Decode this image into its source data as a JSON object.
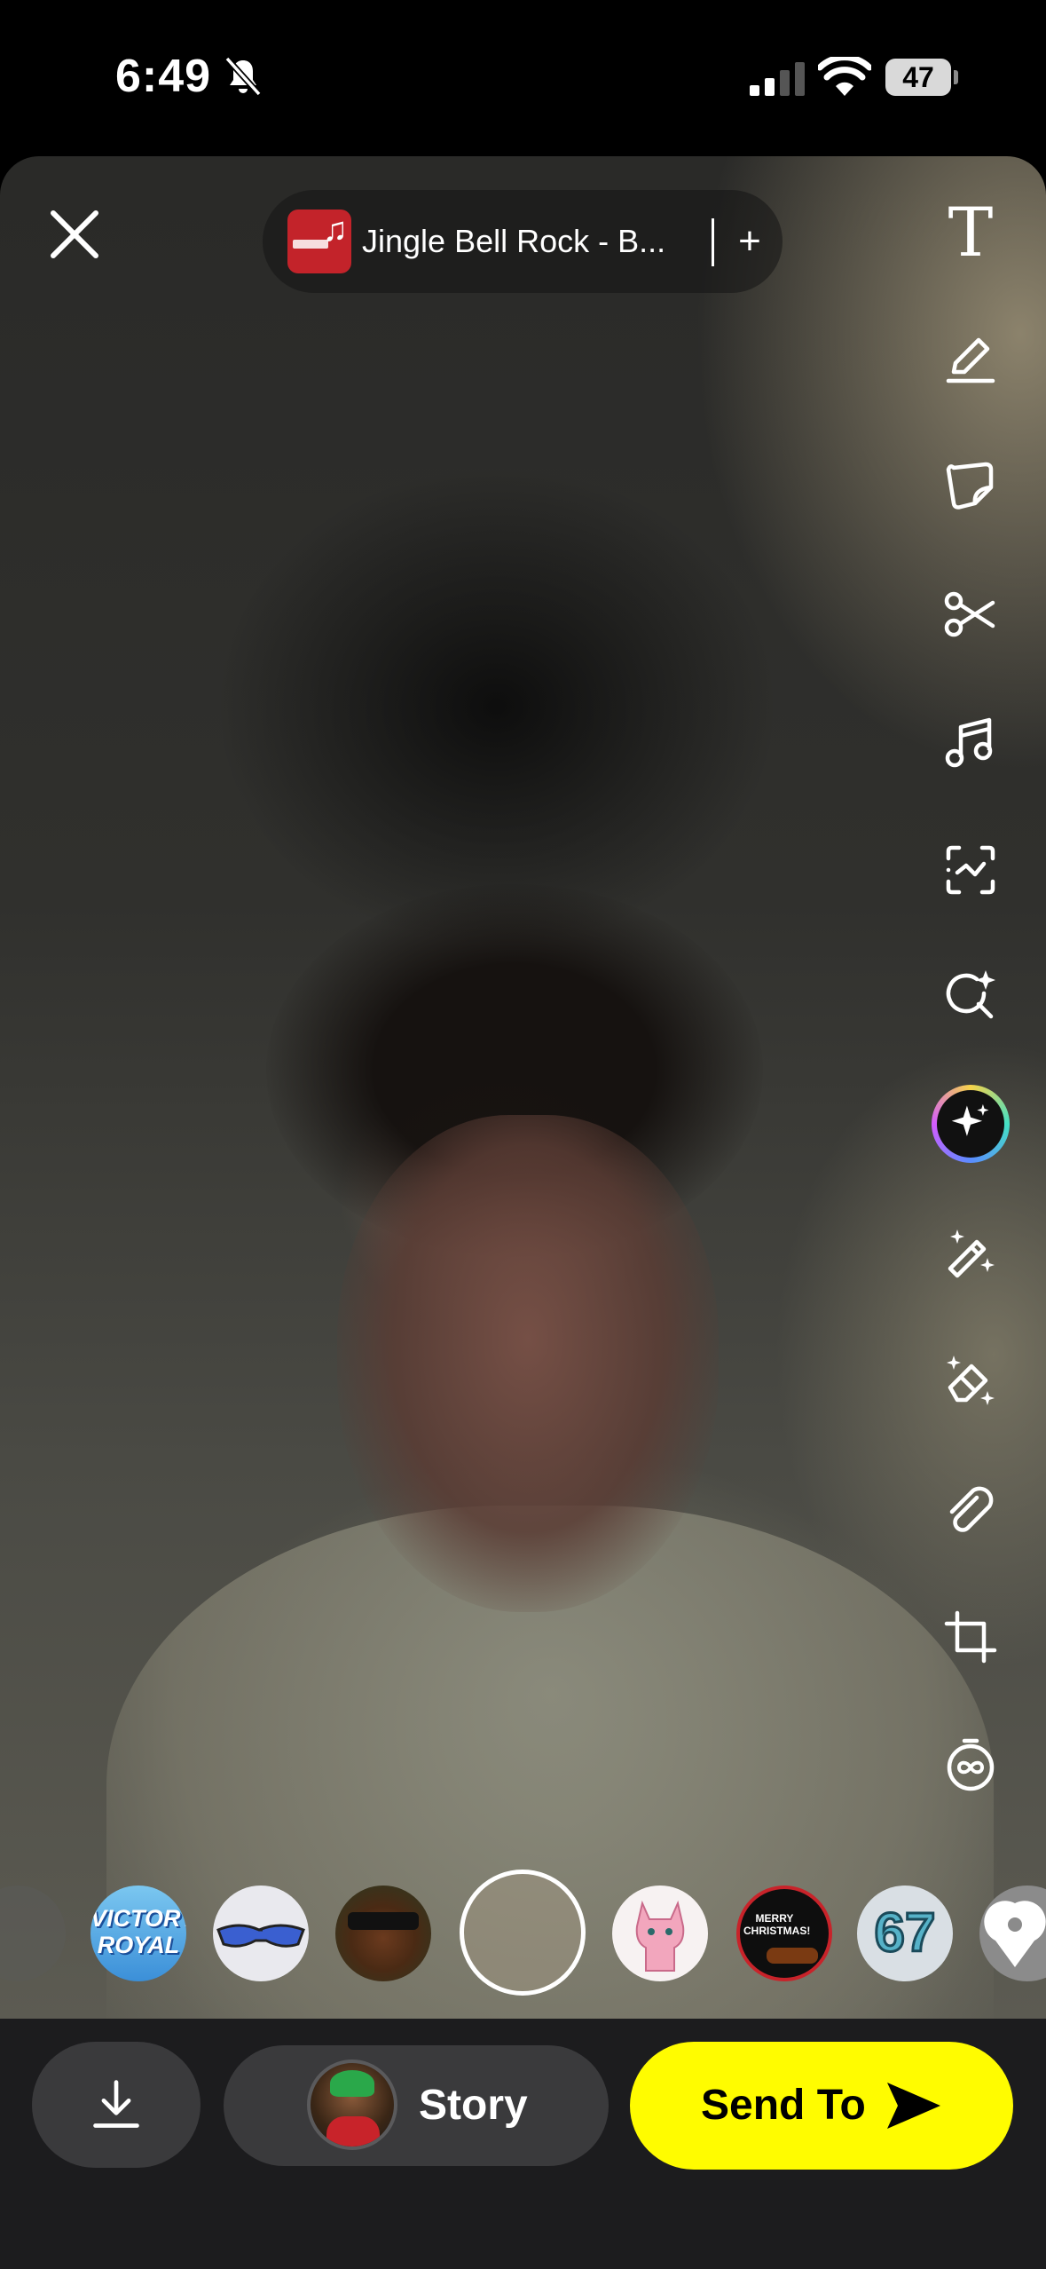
{
  "status_bar": {
    "time": "6:49",
    "battery": "47",
    "icons": [
      "bell-slash-icon",
      "cellular-signal-icon",
      "wifi-icon",
      "battery-icon"
    ]
  },
  "top_bar": {
    "close_icon": "close-icon",
    "music": {
      "track": "Jingle Bell Rock - B...",
      "add_label": "+"
    }
  },
  "tools": {
    "text_label": "T",
    "items": [
      "text-tool",
      "pen-icon",
      "sticker-icon",
      "scissors-icon",
      "music-note-icon",
      "scan-icon",
      "lens-search-icon",
      "ai-sparkle-icon",
      "magic-wand-icon",
      "eraser-sparkle-icon",
      "paperclip-icon",
      "crop-icon",
      "timer-infinity-icon"
    ]
  },
  "carousel": {
    "victory_text": "VICTORY ROYAL",
    "xmas_text": "MERRY CHRISTMAS!",
    "number_sticker": "67"
  },
  "bottom_bar": {
    "story_label": "Story",
    "send_label": "Send To"
  },
  "colors": {
    "accent": "#fffc00",
    "bar_background": "#1c1c1e",
    "button_background": "#3a3a3c"
  }
}
